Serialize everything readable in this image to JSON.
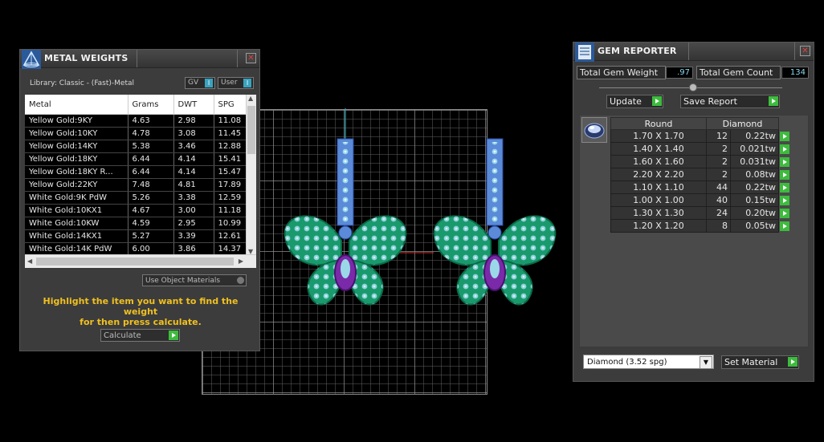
{
  "metal_weights": {
    "title": "METAL WEIGHTS",
    "close_glyph": "✕",
    "library_label": "Library: Classic - (Fast)-Metal",
    "toggles": [
      {
        "label": "GV",
        "state": "I"
      },
      {
        "label": "User",
        "state": "I"
      }
    ],
    "columns": [
      "Metal",
      "Grams",
      "DWT",
      "SPG"
    ],
    "rows": [
      [
        "Yellow Gold:9KY",
        "4.63",
        "2.98",
        "11.08"
      ],
      [
        "Yellow Gold:10KY",
        "4.78",
        "3.08",
        "11.45"
      ],
      [
        "Yellow Gold:14KY",
        "5.38",
        "3.46",
        "12.88"
      ],
      [
        "Yellow Gold:18KY",
        "6.44",
        "4.14",
        "15.41"
      ],
      [
        "Yellow Gold:18KY R...",
        "6.44",
        "4.14",
        "15.47"
      ],
      [
        "Yellow Gold:22KY",
        "7.48",
        "4.81",
        "17.89"
      ],
      [
        "White Gold:9K PdW",
        "5.26",
        "3.38",
        "12.59"
      ],
      [
        "White Gold:10KX1",
        "4.67",
        "3.00",
        "11.18"
      ],
      [
        "White Gold:10KW",
        "4.59",
        "2.95",
        "10.99"
      ],
      [
        "White Gold:14KX1",
        "5.27",
        "3.39",
        "12.61"
      ],
      [
        "White Gold:14K PdW",
        "6.00",
        "3.86",
        "14.37"
      ]
    ],
    "use_object_materials_label": "Use Object Materials",
    "hint_line1": "Highlight the item you want to find the weight",
    "hint_line2": "for then press calculate.",
    "calculate_label": "Calculate"
  },
  "gem_reporter": {
    "title": "GEM REPORTER",
    "close_glyph": "✕",
    "total_weight_label": "Total Gem Weight",
    "total_weight_value": ".97",
    "total_count_label": "Total Gem Count",
    "total_count_value": "134",
    "update_label": "Update",
    "save_report_label": "Save Report",
    "columns": [
      "Round",
      "Diamond"
    ],
    "rows": [
      {
        "size": "1.70 X 1.70",
        "count": "12",
        "weight": "0.22tw"
      },
      {
        "size": "1.40 X 1.40",
        "count": "2",
        "weight": "0.021tw"
      },
      {
        "size": "1.60 X 1.60",
        "count": "2",
        "weight": "0.031tw"
      },
      {
        "size": "2.20 X 2.20",
        "count": "2",
        "weight": "0.08tw"
      },
      {
        "size": "1.10 X 1.10",
        "count": "44",
        "weight": "0.22tw"
      },
      {
        "size": "1.00 X 1.00",
        "count": "40",
        "weight": "0.15tw"
      },
      {
        "size": "1.30 X 1.30",
        "count": "24",
        "weight": "0.20tw"
      },
      {
        "size": "1.20 X 1.20",
        "count": "8",
        "weight": "0.05tw"
      }
    ],
    "material_select": "Diamond    (3.52 spg)",
    "set_material_label": "Set Material"
  },
  "colors": {
    "wing_fill": "#1a9a6c",
    "wing_edge": "#0a6a48",
    "gem_fill": "#9ad8e8",
    "body_fill": "#7a2aa8",
    "bail_fill": "#5a8ad8",
    "accent_green": "#3dbb3d",
    "hint_text": "#f0c020"
  }
}
